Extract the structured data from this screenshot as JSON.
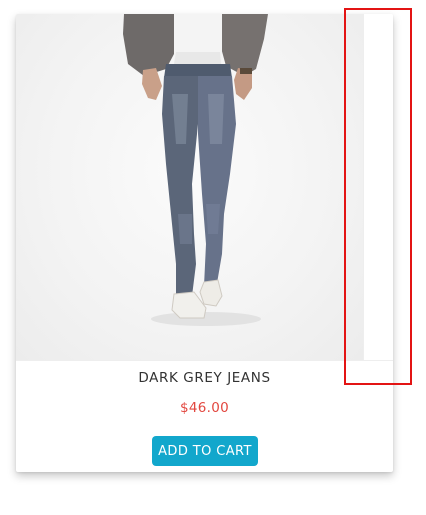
{
  "product": {
    "name": "DARK GREY JEANS",
    "price": "$46.00",
    "image_icon": "jeans-model-photo"
  },
  "actions": {
    "add_to_cart_label": "ADD TO CART"
  },
  "colors": {
    "price": "#e2473f",
    "button": "#12a7cc",
    "highlight": "#e31414"
  }
}
